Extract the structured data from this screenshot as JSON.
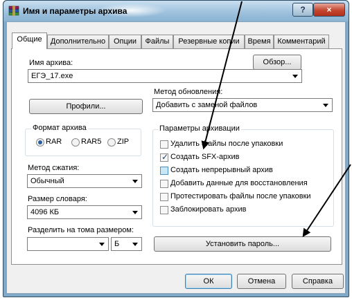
{
  "window": {
    "title": "Имя и параметры архива",
    "help": "?",
    "close": "×"
  },
  "tabs": [
    "Общие",
    "Дополнительно",
    "Опции",
    "Файлы",
    "Резервные копии",
    "Время",
    "Комментарий"
  ],
  "archive": {
    "name_label": "Имя архива:",
    "name_value": "ЕГЭ_17.exe",
    "browse_button": "Обзор..."
  },
  "update": {
    "label": "Метод обновления:",
    "value": "Добавить с заменой файлов"
  },
  "profiles_button": "Профили...",
  "format": {
    "label": "Формат архива",
    "options": [
      "RAR",
      "RAR5",
      "ZIP"
    ],
    "selected": "RAR"
  },
  "compression": {
    "label": "Метод сжатия:",
    "value": "Обычный"
  },
  "dictionary": {
    "label": "Размер словаря:",
    "value": "4096 КБ"
  },
  "split": {
    "label": "Разделить на тома размером:",
    "value": "",
    "unit": "Б"
  },
  "options": {
    "label": "Параметры архивации",
    "items": [
      {
        "label": "Удалить файлы после упаковки",
        "checked": false
      },
      {
        "label": "Создать SFX-архив",
        "checked": true
      },
      {
        "label": "Создать непрерывный архив",
        "checked": false
      },
      {
        "label": "Добавить данные для восстановления",
        "checked": false
      },
      {
        "label": "Протестировать файлы после упаковки",
        "checked": false
      },
      {
        "label": "Заблокировать архив",
        "checked": false
      }
    ]
  },
  "password_button": "Установить пароль...",
  "footer": {
    "ok": "ОК",
    "cancel": "Отмена",
    "help": "Справка"
  },
  "colors": {
    "annotation": "#000000",
    "selected_radio": "#2a5ea3",
    "close_red": "#c3462f"
  }
}
